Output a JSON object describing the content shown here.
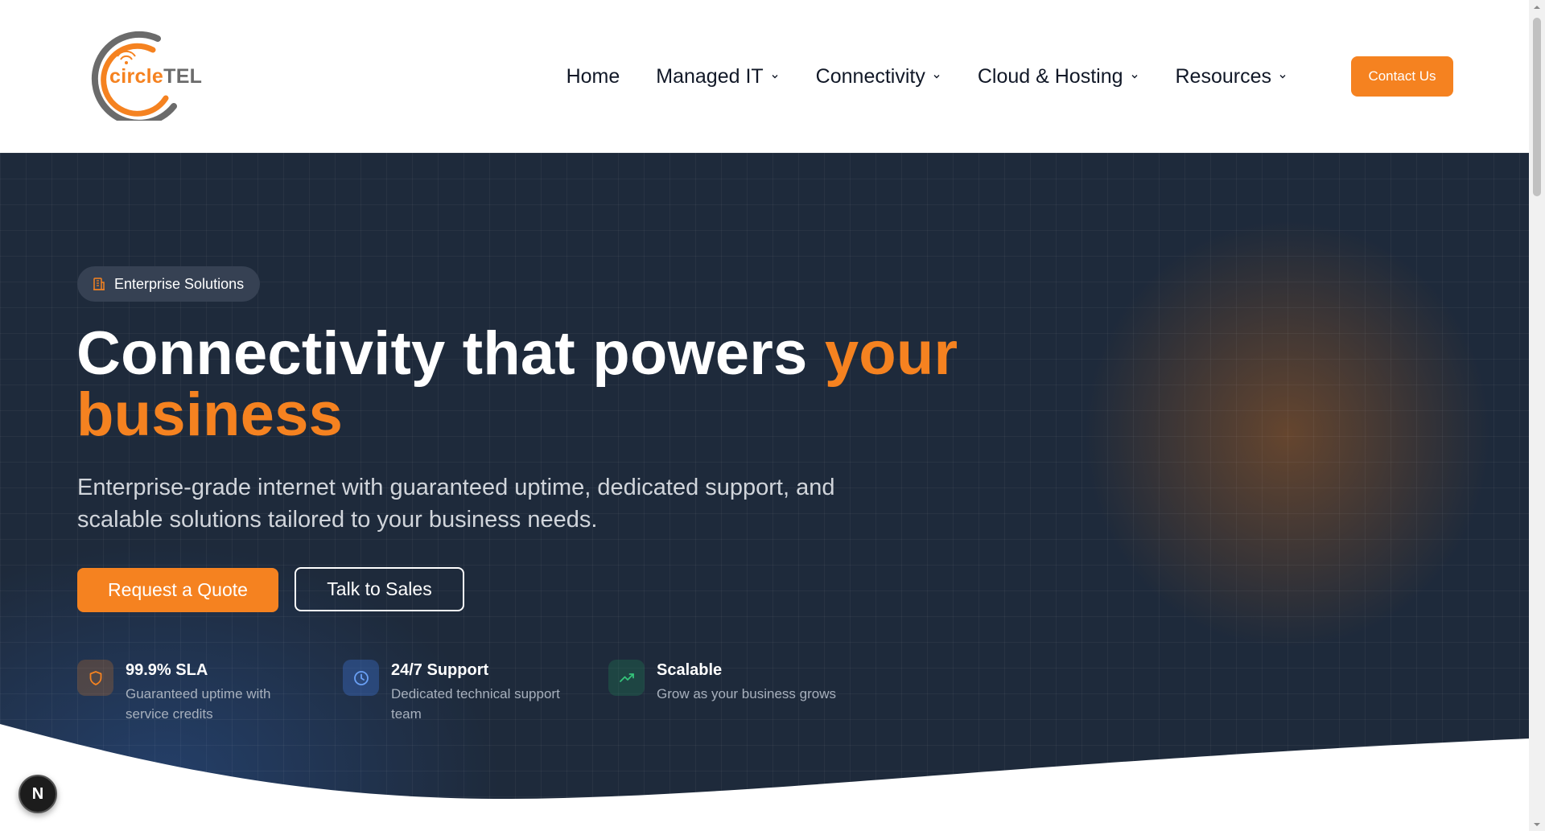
{
  "brand": {
    "name_part1": "circle",
    "name_part2": "TEL",
    "colors": {
      "accent": "#f58220",
      "logo_gray": "#6b6b6b",
      "hero_bg": "#1e2a3b"
    }
  },
  "nav": {
    "items": [
      {
        "label": "Home",
        "has_dropdown": false
      },
      {
        "label": "Managed IT",
        "has_dropdown": true
      },
      {
        "label": "Connectivity",
        "has_dropdown": true
      },
      {
        "label": "Cloud & Hosting",
        "has_dropdown": true
      },
      {
        "label": "Resources",
        "has_dropdown": true
      }
    ],
    "contact_label": "Contact Us"
  },
  "hero": {
    "badge": {
      "icon": "building-icon",
      "label": "Enterprise Solutions"
    },
    "headline_main": "Connectivity that powers ",
    "headline_accent": "your business",
    "subheadline": "Enterprise-grade internet with guaranteed uptime, dedicated support, and scalable solutions tailored to your business needs.",
    "primary_cta": "Request a Quote",
    "secondary_cta": "Talk to Sales",
    "features": [
      {
        "icon": "shield-icon",
        "title": "99.9% SLA",
        "description": "Guaranteed uptime with service credits"
      },
      {
        "icon": "clock-icon",
        "title": "24/7 Support",
        "description": "Dedicated technical support team"
      },
      {
        "icon": "trending-up-icon",
        "title": "Scalable",
        "description": "Grow as your business grows"
      }
    ]
  },
  "floating": {
    "label": "N"
  }
}
